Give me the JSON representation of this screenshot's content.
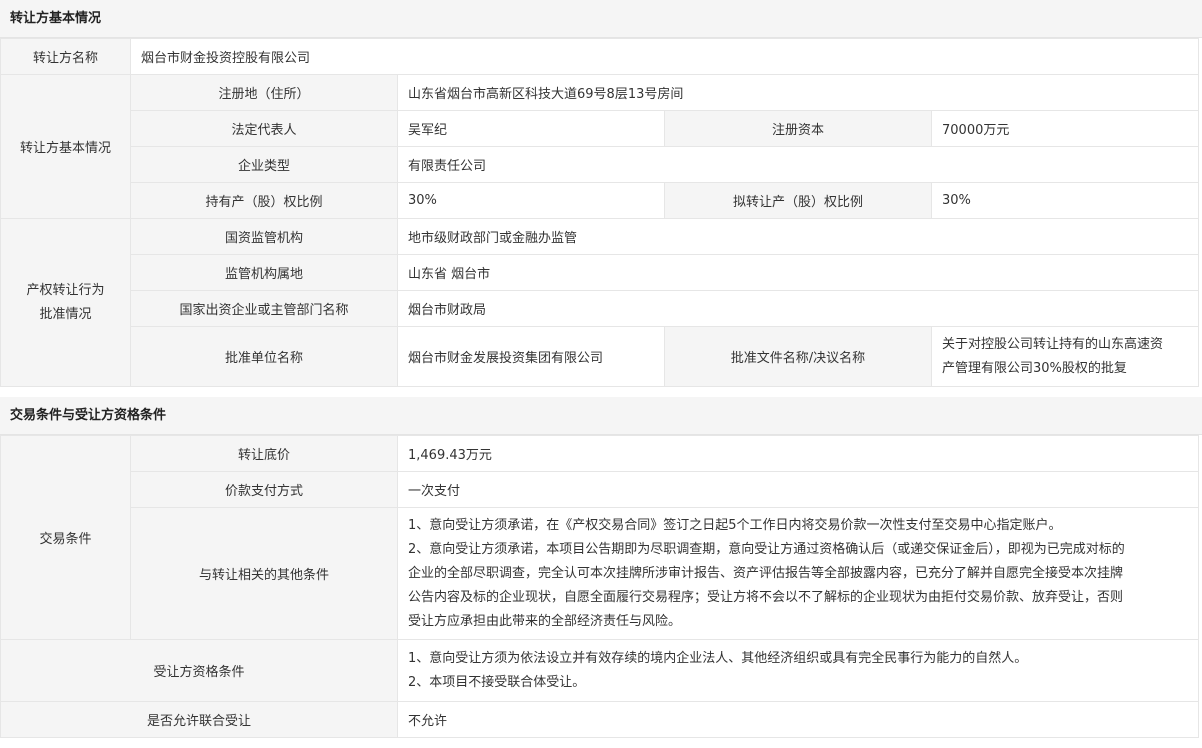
{
  "section1": {
    "title": "转让方基本情况",
    "name_label": "转让方名称",
    "name_value": "烟台市财金投资控股有限公司",
    "basic_group_label": "转让方基本情况",
    "reg_addr_label": "注册地（住所）",
    "reg_addr_value": "山东省烟台市高新区科技大道69号8层13号房间",
    "legal_rep_label": "法定代表人",
    "legal_rep_value": "吴军纪",
    "reg_capital_label": "注册资本",
    "reg_capital_value": "70000万元",
    "company_type_label": "企业类型",
    "company_type_value": "有限责任公司",
    "holding_ratio_label": "持有产（股）权比例",
    "holding_ratio_value": "30%",
    "transfer_ratio_label": "拟转让产（股）权比例",
    "transfer_ratio_value": "30%",
    "approval_group_label_line1": "产权转让行为",
    "approval_group_label_line2": "批准情况",
    "supervisor_label": "国资监管机构",
    "supervisor_value": "地市级财政部门或金融办监管",
    "supervisor_loc_label": "监管机构属地",
    "supervisor_loc_value": "山东省 烟台市",
    "dept_label": "国家出资企业或主管部门名称",
    "dept_value": "烟台市财政局",
    "approver_label": "批准单位名称",
    "approver_value": "烟台市财金发展投资集团有限公司",
    "approval_doc_label": "批准文件名称/决议名称",
    "approval_doc_value_line1": "关于对控股公司转让持有的山东高速资",
    "approval_doc_value_line2": "产管理有限公司30%股权的批复"
  },
  "section2": {
    "title": "交易条件与受让方资格条件",
    "trade_group_label": "交易条件",
    "base_price_label": "转让底价",
    "base_price_value": "1,469.43万元",
    "payment_label": "价款支付方式",
    "payment_value": "一次支付",
    "other_cond_label": "与转让相关的其他条件",
    "other_cond_lines": [
      "1、意向受让方须承诺，在《产权交易合同》签订之日起5个工作日内将交易价款一次性支付至交易中心指定账户。",
      "2、意向受让方须承诺，本项目公告期即为尽职调查期，意向受让方通过资格确认后（或递交保证金后），即视为已完成对标的",
      "企业的全部尽职调查，完全认可本次挂牌所涉审计报告、资产评估报告等全部披露内容，已充分了解并自愿完全接受本次挂牌",
      "公告内容及标的企业现状，自愿全面履行交易程序；受让方将不会以不了解标的企业现状为由拒付交易价款、放弃受让，否则",
      "受让方应承担由此带来的全部经济责任与风险。"
    ],
    "qualification_label": "受让方资格条件",
    "qualification_lines": [
      "1、意向受让方须为依法设立并有效存续的境内企业法人、其他经济组织或具有完全民事行为能力的自然人。",
      "2、本项目不接受联合体受让。"
    ],
    "joint_label": "是否允许联合受让",
    "joint_value": "不允许"
  }
}
